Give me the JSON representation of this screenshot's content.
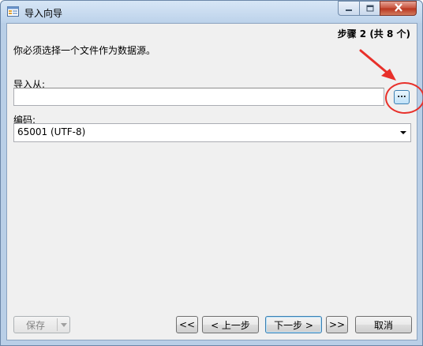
{
  "window": {
    "title": "导入向导"
  },
  "wizard": {
    "step_label": "步骤 2 (共 8 个)",
    "instruction": "你必须选择一个文件作为数据源。"
  },
  "import_from": {
    "label": "导入从:",
    "value": "",
    "browse_label": "..."
  },
  "encoding": {
    "label": "编码:",
    "selected": "65001 (UTF-8)"
  },
  "footer": {
    "save_label": "保存",
    "first_label": "<<",
    "prev_label": "< 上一步",
    "next_label": "下一步 >",
    "last_label": ">>",
    "cancel_label": "取消"
  },
  "colors": {
    "annotation": "#e8302a",
    "title_gradient_top": "#d7e6f6",
    "client_bg": "#f0f0f0"
  }
}
